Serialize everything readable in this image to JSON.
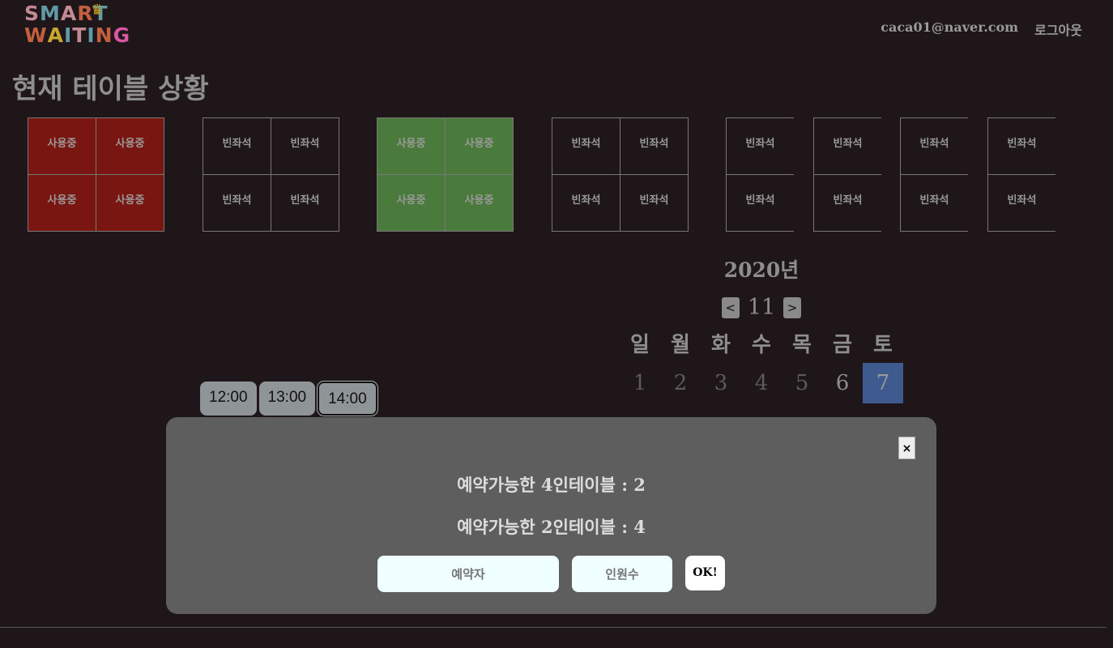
{
  "logo": {
    "line1": "SMART",
    "line2": "WAITING",
    "colors": [
      "#c48a93",
      "#5f9aa6",
      "#c15f3f",
      "#c8a730",
      "#d6569f"
    ]
  },
  "header": {
    "email": "caca01@naver.com",
    "logout": "로그아웃"
  },
  "title": "현재 테이블 상황",
  "tables": [
    {
      "status": "used",
      "color": "#7a1611",
      "cells": [
        "사용중",
        "사용중",
        "사용중",
        "사용중"
      ]
    },
    {
      "status": "empty",
      "cells": [
        "빈좌석",
        "빈좌석",
        "빈좌석",
        "빈좌석"
      ]
    },
    {
      "status": "used",
      "color": "#4a7a3c",
      "cells": [
        "사용중",
        "사용중",
        "사용중",
        "사용중"
      ]
    },
    {
      "status": "empty",
      "cells": [
        "빈좌석",
        "빈좌석",
        "빈좌석",
        "빈좌석"
      ]
    },
    {
      "status": "empty",
      "cells": [
        "빈좌석",
        "빈좌석"
      ]
    },
    {
      "status": "empty",
      "cells": [
        "빈좌석",
        "빈좌석"
      ]
    },
    {
      "status": "empty",
      "cells": [
        "빈좌석",
        "빈좌석"
      ]
    },
    {
      "status": "empty",
      "cells": [
        "빈좌석",
        "빈좌석"
      ]
    }
  ],
  "calendar": {
    "year": "2020년",
    "prev": "<",
    "month": "11",
    "next": ">",
    "weekdays": [
      "일",
      "월",
      "화",
      "수",
      "목",
      "금",
      "토"
    ],
    "days": [
      "1",
      "2",
      "3",
      "4",
      "5",
      "6",
      "7"
    ],
    "selected_day": "7",
    "selected_color": "#3e5a8e"
  },
  "times": [
    "12:00",
    "13:00",
    "14:00"
  ],
  "selected_time": "14:00",
  "modal": {
    "close": "×",
    "line1": "예약가능한 4인테이블 : 2",
    "line2": "예약가능한 2인테이블 : 4",
    "name_placeholder": "예약자",
    "count_placeholder": "인원수",
    "ok": "OK!"
  }
}
